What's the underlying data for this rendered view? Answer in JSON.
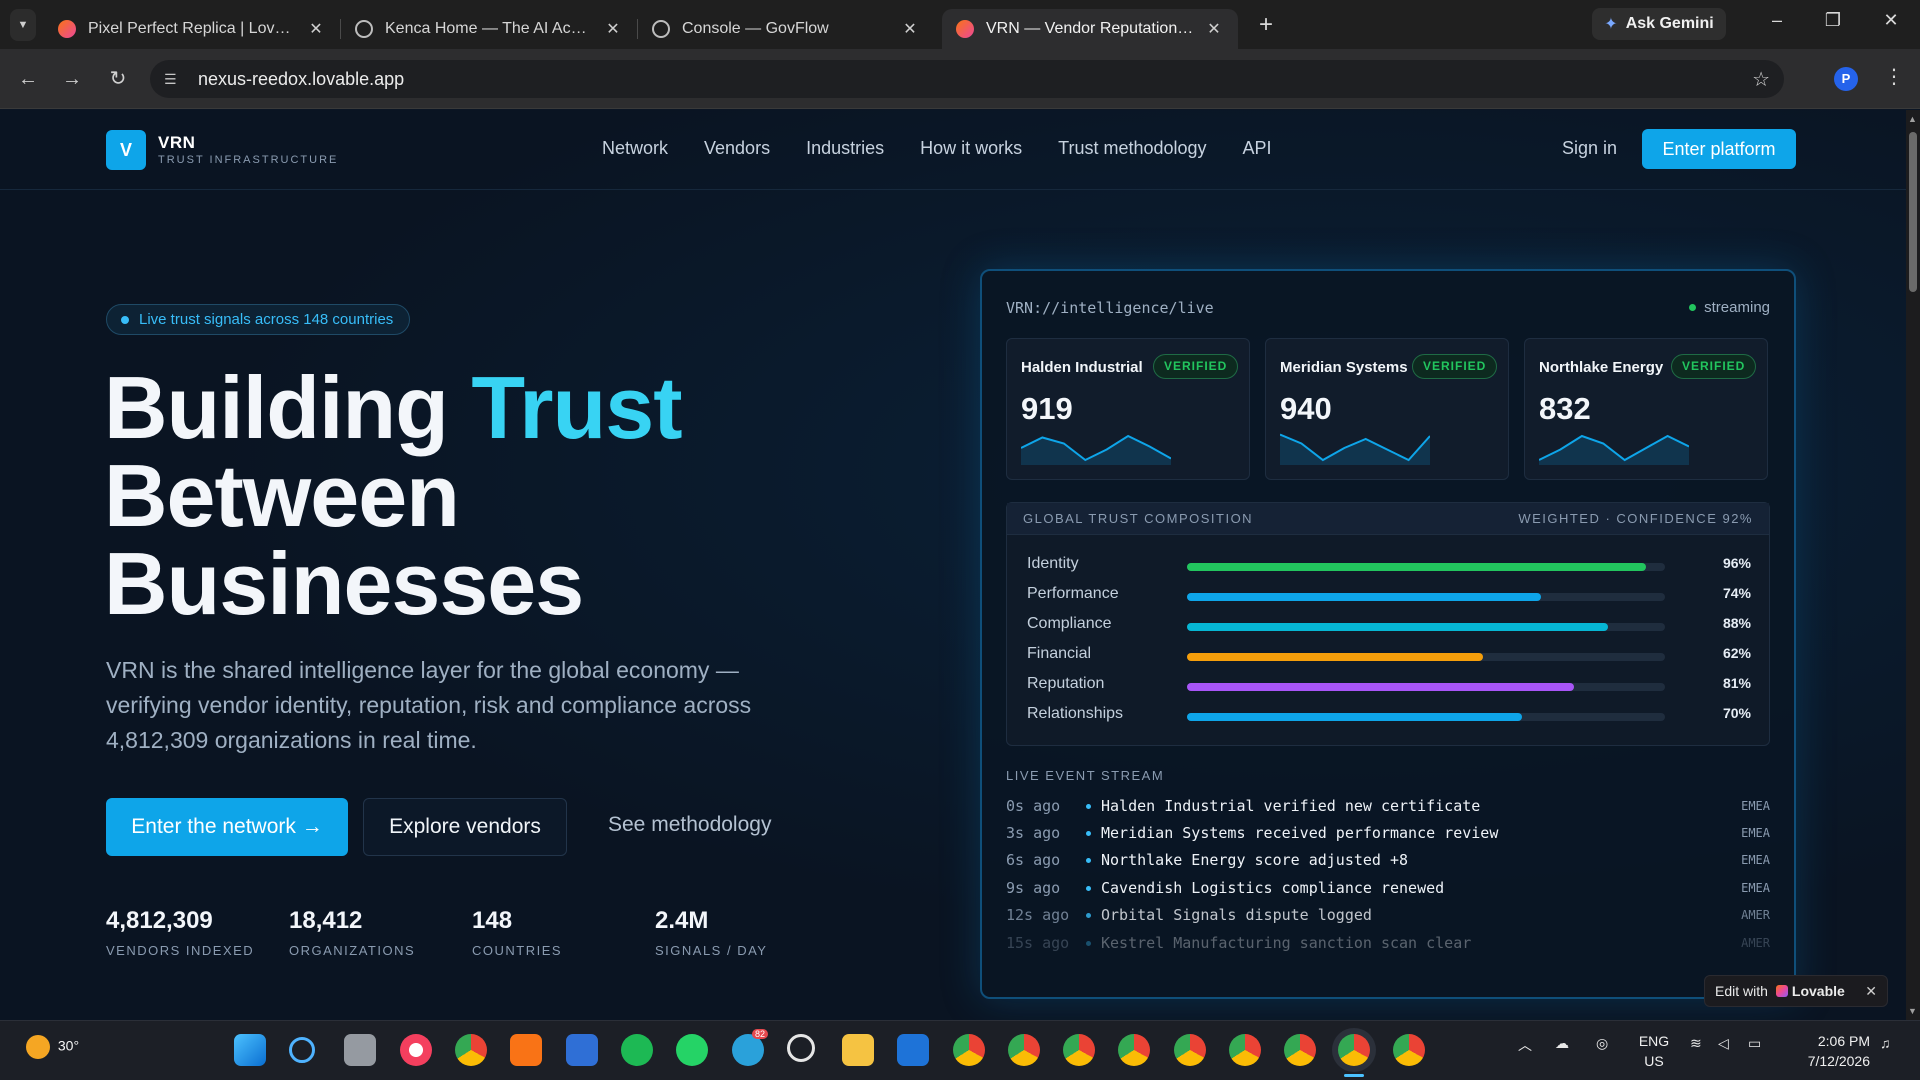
{
  "browser": {
    "tabs": [
      {
        "title": "Pixel Perfect Replica | Lovable",
        "color": "#ec4899"
      },
      {
        "title": "Kenca Home — The AI Academy",
        "color": "#9aa0a6"
      },
      {
        "title": "Console — GovFlow",
        "color": "#9aa0a6"
      },
      {
        "title": "VRN — Vendor Reputation Network",
        "color": "#ec4899"
      }
    ],
    "gemini_label": "Ask Gemini",
    "url": "nexus-reedox.lovable.app",
    "profile_initial": "P"
  },
  "site": {
    "logo_letter": "V",
    "logo_name": "VRN",
    "logo_sub": "TRUST INFRASTRUCTURE",
    "nav": [
      "Network",
      "Vendors",
      "Industries",
      "How it works",
      "Trust methodology",
      "API"
    ],
    "signin": "Sign in",
    "enter_platform": "Enter platform"
  },
  "hero": {
    "pill": "Live trust signals across 148 countries",
    "headline_1": "Building ",
    "headline_accent": "Trust",
    "headline_2": "Between",
    "headline_3": "Businesses",
    "lede": "VRN is the shared intelligence layer for the global economy — verifying vendor identity, reputation, risk and compliance across 4,812,309 organizations in real time.",
    "btn_primary": "Enter the network →",
    "btn_secondary": "Explore vendors",
    "btn_link": "See methodology",
    "stats": [
      {
        "value": "4,812,309",
        "label": "VENDORS INDEXED"
      },
      {
        "value": "18,412",
        "label": "ORGANIZATIONS"
      },
      {
        "value": "148",
        "label": "COUNTRIES"
      },
      {
        "value": "2.4M",
        "label": "SIGNALS / DAY"
      }
    ]
  },
  "panel": {
    "path": "VRN://intelligence/live",
    "status": "streaming",
    "vendors": [
      {
        "name": "Halden Industrial",
        "badge": "VERIFIED",
        "score": "919",
        "spark": [
          0.5,
          0.15,
          0.35,
          0.9,
          0.55,
          0.1,
          0.45,
          0.85
        ]
      },
      {
        "name": "Meridian Systems",
        "badge": "VERIFIED",
        "score": "940",
        "spark": [
          0.05,
          0.35,
          0.9,
          0.5,
          0.2,
          0.55,
          0.9,
          0.1
        ]
      },
      {
        "name": "Northlake Energy",
        "badge": "VERIFIED",
        "score": "832",
        "spark": [
          0.9,
          0.55,
          0.1,
          0.35,
          0.9,
          0.5,
          0.1,
          0.45
        ]
      }
    ],
    "composition": {
      "title": "GLOBAL TRUST COMPOSITION",
      "meta": "WEIGHTED · CONFIDENCE 92%",
      "rows": [
        {
          "label": "Identity",
          "value": 96,
          "pct": "96%",
          "color": "#22c55e"
        },
        {
          "label": "Performance",
          "value": 74,
          "pct": "74%",
          "color": "#0ea5e9"
        },
        {
          "label": "Compliance",
          "value": 88,
          "pct": "88%",
          "color": "#06b6d4"
        },
        {
          "label": "Financial",
          "value": 62,
          "pct": "62%",
          "color": "#f59e0b"
        },
        {
          "label": "Reputation",
          "value": 81,
          "pct": "81%",
          "color": "#a855f7"
        },
        {
          "label": "Relationships",
          "value": 70,
          "pct": "70%",
          "color": "#0ea5e9"
        }
      ]
    },
    "events_title": "LIVE EVENT STREAM",
    "events": [
      {
        "time": "0s ago",
        "msg": "Halden Industrial verified new certificate",
        "region": "EMEA"
      },
      {
        "time": "3s ago",
        "msg": "Meridian Systems received performance review",
        "region": "EMEA"
      },
      {
        "time": "6s ago",
        "msg": "Northlake Energy score adjusted +8",
        "region": "EMEA"
      },
      {
        "time": "9s ago",
        "msg": "Cavendish Logistics compliance renewed",
        "region": "EMEA"
      },
      {
        "time": "12s ago",
        "msg": "Orbital Signals dispute logged",
        "region": "AMER"
      },
      {
        "time": "15s ago",
        "msg": "Kestrel Manufacturing sanction scan clear",
        "region": "AMER"
      }
    ]
  },
  "lovable_badge": {
    "prefix": "Edit with",
    "brand": "Lovable"
  },
  "taskbar": {
    "temp": "30°",
    "lang_1": "ENG",
    "lang_2": "US",
    "time": "2:06 PM",
    "date": "7/12/2026",
    "telegram_badge": "82"
  }
}
